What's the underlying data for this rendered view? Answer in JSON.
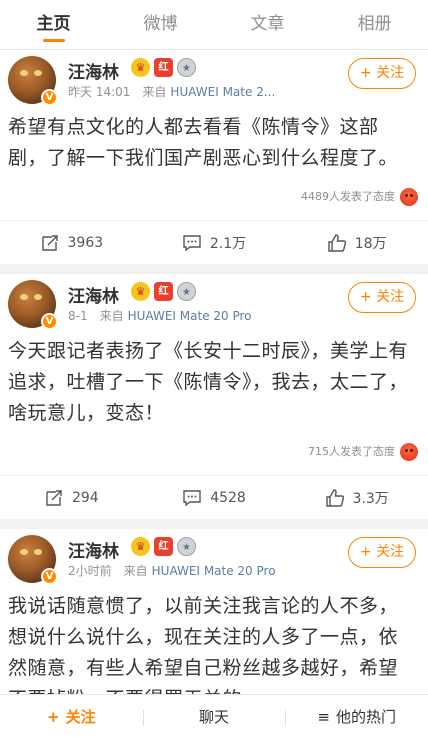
{
  "tabs": [
    {
      "label": "主页",
      "active": true
    },
    {
      "label": "微博",
      "active": false
    },
    {
      "label": "文章",
      "active": false
    },
    {
      "label": "相册",
      "active": false
    }
  ],
  "follow_label": "+ 关注",
  "source_label": "来自",
  "avatar_badge": "V",
  "posts": [
    {
      "user": "汪海林",
      "time": "昨天 14:01",
      "device": "HUAWEI Mate 2...",
      "text": "希望有点文化的人都去看看《陈情令》这部剧，了解一下我们国产剧恶心到什么程度了。",
      "reactions": "4489人发表了态度",
      "reposts": "3963",
      "comments": "2.1万",
      "likes": "18万"
    },
    {
      "user": "汪海林",
      "time": "8-1",
      "device": "HUAWEI Mate 20 Pro",
      "text": "今天跟记者表扬了《长安十二时辰》，美学上有追求，吐槽了一下《陈情令》，我去，太二了，啥玩意儿，变态！",
      "reactions": "715人发表了态度",
      "reposts": "294",
      "comments": "4528",
      "likes": "3.3万"
    },
    {
      "user": "汪海林",
      "time": "2小时前",
      "device": "HUAWEI Mate 20 Pro",
      "text": "我说话随意惯了，以前关注我言论的人不多，想说什么说什么，现在关注的人多了一点，依然随意，有些人希望自己粉丝越多越好，希望不要掉粉，不要得罪无关的"
    }
  ],
  "bottom_bar": {
    "follow": "关注",
    "follow_icon": "+",
    "chat": "聊天",
    "hot": "他的热门",
    "hot_icon": "menu-icon"
  },
  "colors": {
    "accent": "#ff8200",
    "link": "#5b7da8"
  }
}
